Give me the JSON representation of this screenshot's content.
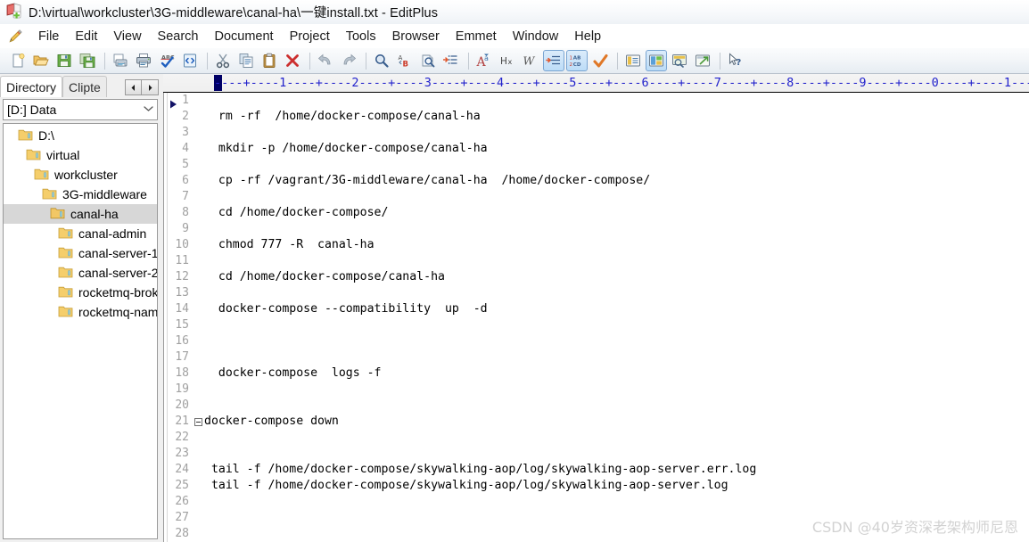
{
  "window": {
    "title": "D:\\virtual\\workcluster\\3G-middleware\\canal-ha\\一键install.txt - EditPlus",
    "app_icon": "editplus-book-icon"
  },
  "menubar": {
    "app_icon": "pencil-icon",
    "items": [
      {
        "label": "File"
      },
      {
        "label": "Edit"
      },
      {
        "label": "View"
      },
      {
        "label": "Search"
      },
      {
        "label": "Document"
      },
      {
        "label": "Project"
      },
      {
        "label": "Tools"
      },
      {
        "label": "Browser"
      },
      {
        "label": "Emmet"
      },
      {
        "label": "Window"
      },
      {
        "label": "Help"
      }
    ]
  },
  "toolbar": {
    "groups": [
      [
        {
          "icon": "new-file-icon",
          "active": false
        },
        {
          "icon": "open-folder-icon",
          "active": false
        },
        {
          "icon": "save-icon",
          "active": false
        },
        {
          "icon": "save-all-icon",
          "active": false
        }
      ],
      [
        {
          "icon": "print-preview-icon",
          "active": false
        },
        {
          "icon": "print-icon",
          "active": false
        },
        {
          "icon": "spellcheck-icon",
          "active": false
        },
        {
          "icon": "view-source-icon",
          "active": false
        }
      ],
      [
        {
          "icon": "cut-scissors-icon",
          "active": false
        },
        {
          "icon": "copy-icon",
          "active": false
        },
        {
          "icon": "paste-clipboard-icon",
          "active": false
        },
        {
          "icon": "delete-x-icon",
          "active": false
        }
      ],
      [
        {
          "icon": "undo-arrow-icon",
          "active": false
        },
        {
          "icon": "redo-arrow-icon",
          "active": false
        }
      ],
      [
        {
          "icon": "find-magnifier-icon",
          "active": false
        },
        {
          "icon": "replace-ab-icon",
          "active": false
        },
        {
          "icon": "find-in-files-icon",
          "active": false
        },
        {
          "icon": "goto-line-icon",
          "active": false
        }
      ],
      [
        {
          "icon": "font-format-icon",
          "active": false
        },
        {
          "icon": "hex-viewer-icon",
          "active": false
        },
        {
          "icon": "word-wrap-icon",
          "active": false
        },
        {
          "icon": "indent-icon",
          "active": true
        },
        {
          "icon": "line-numbers-icon",
          "active": true
        },
        {
          "icon": "checkmark-icon",
          "active": false
        }
      ],
      [
        {
          "icon": "document-selector-icon",
          "active": false
        },
        {
          "icon": "toggle-panel-icon",
          "active": true
        },
        {
          "icon": "preview-browser-icon",
          "active": false
        },
        {
          "icon": "external-browser-icon",
          "active": false
        }
      ],
      [
        {
          "icon": "context-help-icon",
          "active": false
        }
      ]
    ]
  },
  "sidebar": {
    "tabs": [
      {
        "label": "Directory",
        "selected": true
      },
      {
        "label": "Clipte",
        "selected": false
      }
    ],
    "spinner": {
      "prev_icon": "triangle-left-icon",
      "next_icon": "triangle-right-icon"
    },
    "drive_selector": {
      "value": "[D:] Data",
      "chevron_icon": "chevron-down-icon"
    },
    "tree": [
      {
        "label": "D:\\",
        "depth": 0,
        "selected": false
      },
      {
        "label": "virtual",
        "depth": 1,
        "selected": false
      },
      {
        "label": "workcluster",
        "depth": 2,
        "selected": false
      },
      {
        "label": "3G-middleware",
        "depth": 3,
        "selected": false
      },
      {
        "label": "canal-ha",
        "depth": 4,
        "selected": true
      },
      {
        "label": "canal-admin",
        "depth": 5,
        "selected": false
      },
      {
        "label": "canal-server-1",
        "depth": 5,
        "selected": false
      },
      {
        "label": "canal-server-2",
        "depth": 5,
        "selected": false
      },
      {
        "label": "rocketmq-brok",
        "depth": 5,
        "selected": false
      },
      {
        "label": "rocketmq-nam",
        "depth": 5,
        "selected": false
      }
    ]
  },
  "editor": {
    "ruler": "----+----1----+----2----+----3----+----4----+----5----+----6----+----7----+----8----+----9----+----0----+----1----",
    "caret_marker": "column-caret-marker",
    "bookmark_icon": "bookmark-triangle-icon",
    "lines": [
      {
        "n": "1",
        "text": "",
        "fold": false
      },
      {
        "n": "2",
        "text": "  rm -rf  /home/docker-compose/canal-ha",
        "fold": false
      },
      {
        "n": "3",
        "text": "",
        "fold": false
      },
      {
        "n": "4",
        "text": "  mkdir -p /home/docker-compose/canal-ha",
        "fold": false
      },
      {
        "n": "5",
        "text": "",
        "fold": false
      },
      {
        "n": "6",
        "text": "  cp -rf /vagrant/3G-middleware/canal-ha  /home/docker-compose/",
        "fold": false
      },
      {
        "n": "7",
        "text": "",
        "fold": false
      },
      {
        "n": "8",
        "text": "  cd /home/docker-compose/",
        "fold": false
      },
      {
        "n": "9",
        "text": "",
        "fold": false
      },
      {
        "n": "10",
        "text": "  chmod 777 -R  canal-ha",
        "fold": false
      },
      {
        "n": "11",
        "text": "",
        "fold": false
      },
      {
        "n": "12",
        "text": "  cd /home/docker-compose/canal-ha",
        "fold": false
      },
      {
        "n": "13",
        "text": "",
        "fold": false
      },
      {
        "n": "14",
        "text": "  docker-compose --compatibility  up  -d",
        "fold": false
      },
      {
        "n": "15",
        "text": "",
        "fold": false
      },
      {
        "n": "16",
        "text": "",
        "fold": false
      },
      {
        "n": "17",
        "text": "",
        "fold": false
      },
      {
        "n": "18",
        "text": "  docker-compose  logs -f",
        "fold": false
      },
      {
        "n": "19",
        "text": "",
        "fold": false
      },
      {
        "n": "20",
        "text": "",
        "fold": false
      },
      {
        "n": "21",
        "text": "docker-compose down",
        "fold": true
      },
      {
        "n": "22",
        "text": "",
        "fold": false
      },
      {
        "n": "23",
        "text": "",
        "fold": false
      },
      {
        "n": "24",
        "text": " tail -f /home/docker-compose/skywalking-aop/log/skywalking-aop-server.err.log",
        "fold": false
      },
      {
        "n": "25",
        "text": " tail -f /home/docker-compose/skywalking-aop/log/skywalking-aop-server.log",
        "fold": false
      },
      {
        "n": "26",
        "text": "",
        "fold": false
      },
      {
        "n": "27",
        "text": "",
        "fold": false
      },
      {
        "n": "28",
        "text": "",
        "fold": false
      }
    ]
  },
  "watermark": {
    "text": "CSDN @40岁资深老架构师尼恩"
  },
  "colors": {
    "ruler_text": "#2222cc",
    "line_number": "#a0a0a0",
    "code_text": "#000000",
    "selection": "#d7d7d7",
    "folder": "#f5ce6b",
    "watermark": "#d2d2d2"
  }
}
